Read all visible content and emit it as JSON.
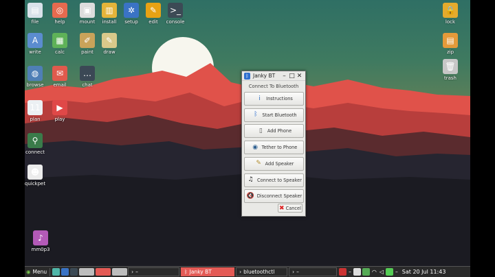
{
  "desktop": {
    "left_icons": [
      {
        "label": "file",
        "icon": "folder-icon",
        "color": "#d9e2ea",
        "glyph": "▤"
      },
      {
        "label": "help",
        "icon": "lifebuoy-icon",
        "color": "#e66a4f",
        "glyph": "◎"
      },
      {
        "label": "mount",
        "icon": "drive-icon",
        "color": "#ddd",
        "glyph": "▣"
      },
      {
        "label": "install",
        "icon": "package-icon",
        "color": "#e4b43a",
        "glyph": "▥"
      },
      {
        "label": "setup",
        "icon": "gear-icon",
        "color": "#3a73c5",
        "glyph": "✲"
      },
      {
        "label": "edit",
        "icon": "editor-icon",
        "color": "#e8a214",
        "glyph": "✎"
      },
      {
        "label": "console",
        "icon": "terminal-icon",
        "color": "#3c4a55",
        "glyph": ">_"
      },
      {
        "label": "write",
        "icon": "write-icon",
        "color": "#5b8ccf",
        "glyph": "A"
      },
      {
        "label": "calc",
        "icon": "spreadsheet-icon",
        "color": "#5fb258",
        "glyph": "▦"
      },
      {
        "label": "paint",
        "icon": "paint-icon",
        "color": "#c9a35a",
        "glyph": "✐"
      },
      {
        "label": "draw",
        "icon": "draw-icon",
        "color": "#d9c98a",
        "glyph": "✎"
      },
      {
        "label": "browse",
        "icon": "globe-icon",
        "color": "#4f7fb6",
        "glyph": "◍"
      },
      {
        "label": "email",
        "icon": "email-icon",
        "color": "#e05a4d",
        "glyph": "✉"
      },
      {
        "label": "chat",
        "icon": "chat-icon",
        "color": "#3b4855",
        "glyph": "…"
      },
      {
        "label": "plan",
        "icon": "calendar-icon",
        "color": "#ecf0f3",
        "glyph": "11"
      },
      {
        "label": "play",
        "icon": "play-icon",
        "color": "#e04848",
        "glyph": "▶"
      },
      {
        "label": "connect",
        "icon": "network-icon",
        "color": "#3a7b4a",
        "glyph": "⚲"
      },
      {
        "label": "quickpet",
        "icon": "quickpet-icon",
        "color": "#ececec",
        "glyph": "☻"
      },
      {
        "label": "mm0p3",
        "icon": "music-icon",
        "color": "#b35ab7",
        "glyph": "♪"
      }
    ],
    "right_icons": [
      {
        "label": "lock",
        "icon": "lock-icon",
        "color": "#e4ab2d",
        "glyph": "🔒"
      },
      {
        "label": "zip",
        "icon": "archive-icon",
        "color": "#e49a3a",
        "glyph": "▤"
      },
      {
        "label": "trash",
        "icon": "trash-icon",
        "color": "#c7c7c7",
        "glyph": "🗑"
      }
    ]
  },
  "dialog": {
    "title": "Janky BT",
    "heading": "Connect To Bluetooth",
    "buttons": [
      {
        "label": "Instructions",
        "icon": "info-icon",
        "glyph": "i",
        "color": "#2f6fbf"
      },
      {
        "label": "Start Bluetooth",
        "icon": "bluetooth-icon",
        "glyph": "ᛒ",
        "color": "#2f6fcf"
      },
      {
        "label": "Add Phone",
        "icon": "phone-icon",
        "glyph": "▯",
        "color": "#555"
      },
      {
        "label": "Tether to Phone",
        "icon": "tether-icon",
        "glyph": "◉",
        "color": "#2c5e8f"
      },
      {
        "label": "Add Speaker",
        "icon": "add-speaker-icon",
        "glyph": "✎",
        "color": "#b08a2a"
      },
      {
        "label": "Connect to Speaker",
        "icon": "music-note-icon",
        "glyph": "♫",
        "color": "#111"
      },
      {
        "label": "Disconnect Speaker",
        "icon": "mute-speaker-icon",
        "glyph": "🔇",
        "color": "#c22"
      }
    ],
    "cancel_label": "Cancel"
  },
  "taskbar": {
    "menu_label": "Menu",
    "window_1": "Janky BT",
    "window_2": "bluetoothctl",
    "dash_1": "–",
    "dash_2": "–",
    "dash_3": "–",
    "dash_4": "–",
    "clock": "Sat 20 Jul 11:43"
  }
}
